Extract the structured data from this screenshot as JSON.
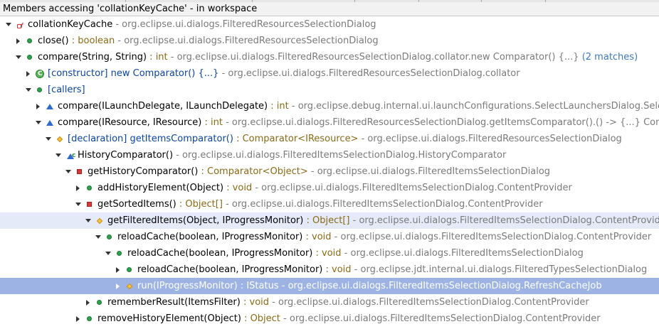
{
  "header": {
    "title": "Members accessing 'collationKeyCache' - in workspace"
  },
  "rows": [
    {
      "name": "collationKeyCache",
      "suffix": "",
      "qualifier": " - org.eclipse.ui.dialogs.FilteredResourcesSelectionDialog",
      "matches": "",
      "icon": "field-icon"
    },
    {
      "name": "close()",
      "suffix": " : boolean",
      "qualifier": " - org.eclipse.ui.dialogs.FilteredResourcesSelectionDialog",
      "matches": "",
      "icon": "public-method-icon"
    },
    {
      "name": "compare(String, String)",
      "suffix": " : int",
      "qualifier": " - org.eclipse.ui.dialogs.FilteredResourcesSelectionDialog.collator.new Comparator() {...}",
      "matches": " (2 matches)",
      "icon": "public-method-icon"
    },
    {
      "name": "[constructor] new Comparator() {...}",
      "suffix": "",
      "qualifier": " - org.eclipse.ui.dialogs.FilteredResourcesSelectionDialog.collator",
      "matches": "",
      "icon": "anonymous-class-icon"
    },
    {
      "name": "[callers]",
      "suffix": "",
      "qualifier": "",
      "matches": "",
      "icon": "public-method-icon"
    },
    {
      "name": "compare(ILaunchDelegate, ILaunchDelegate)",
      "suffix": " : int",
      "qualifier": " - org.eclipse.debug.internal.ui.launchConfigurations.SelectLaunchersDialog.Sele",
      "matches": "",
      "icon": "default-method-icon"
    },
    {
      "name": "compare(IResource, IResource)",
      "suffix": " : int",
      "qualifier": " - org.eclipse.ui.dialogs.FilteredResourcesSelectionDialog.getItemsComparator().() -> {...} Com",
      "matches": "",
      "icon": "default-method-icon"
    },
    {
      "name": "[declaration] getItemsComparator()",
      "suffix": " : Comparator<IResource>",
      "qualifier": " - org.eclipse.ui.dialogs.FilteredResourcesSelectionDialog",
      "matches": "",
      "icon": "protected-method-icon"
    },
    {
      "name": "HistoryComparator()",
      "suffix": "",
      "qualifier": " - org.eclipse.ui.dialogs.FilteredItemsSelectionDialog.HistoryComparator",
      "matches": "",
      "icon": "constructor-icon"
    },
    {
      "name": "getHistoryComparator()",
      "suffix": " : Comparator<Object>",
      "qualifier": " - org.eclipse.ui.dialogs.FilteredItemsSelectionDialog",
      "matches": "",
      "icon": "private-method-icon"
    },
    {
      "name": "addHistoryElement(Object)",
      "suffix": " : void",
      "qualifier": " - org.eclipse.ui.dialogs.FilteredItemsSelectionDialog.ContentProvider",
      "matches": "",
      "icon": "public-method-icon"
    },
    {
      "name": "getSortedItems()",
      "suffix": " : Object[]",
      "qualifier": " - org.eclipse.ui.dialogs.FilteredItemsSelectionDialog.ContentProvider",
      "matches": "",
      "icon": "private-method-icon"
    },
    {
      "name": "getFilteredItems(Object, IProgressMonitor)",
      "suffix": " : Object[]",
      "qualifier": " - org.eclipse.ui.dialogs.FilteredItemsSelectionDialog.ContentProvid",
      "matches": "",
      "icon": "protected-method-icon"
    },
    {
      "name": "reloadCache(boolean, IProgressMonitor)",
      "suffix": " : void",
      "qualifier": " - org.eclipse.ui.dialogs.FilteredItemsSelectionDialog.ContentProvider",
      "matches": "",
      "icon": "public-method-icon"
    },
    {
      "name": "reloadCache(boolean, IProgressMonitor)",
      "suffix": " : void",
      "qualifier": " - org.eclipse.ui.dialogs.FilteredItemsSelectionDialog",
      "matches": "",
      "icon": "public-method-icon"
    },
    {
      "name": "reloadCache(boolean, IProgressMonitor)",
      "suffix": " : void",
      "qualifier": " - org.eclipse.jdt.internal.ui.dialogs.FilteredTypesSelectionDialog",
      "matches": "",
      "icon": "public-method-icon"
    },
    {
      "name": "run(IProgressMonitor)",
      "suffix": " : IStatus",
      "qualifier": " - org.eclipse.ui.dialogs.FilteredItemsSelectionDialog.RefreshCacheJob",
      "matches": "",
      "icon": "protected-method-icon"
    },
    {
      "name": "rememberResult(ItemsFilter)",
      "suffix": " : void",
      "qualifier": " - org.eclipse.ui.dialogs.FilteredItemsSelectionDialog.ContentProvider",
      "matches": "",
      "icon": "public-method-icon"
    },
    {
      "name": "removeHistoryElement(Object)",
      "suffix": " : Object",
      "qualifier": " - org.eclipse.ui.dialogs.FilteredItemsSelectionDialog.ContentProvider",
      "matches": "",
      "icon": "public-method-icon"
    }
  ],
  "colors": {
    "selection": "#9db3e3",
    "focus": "#e4eaf8",
    "type_suffix": "#8b6a13",
    "qualifier": "#7a7a7a",
    "matches": "#3a78c8"
  }
}
